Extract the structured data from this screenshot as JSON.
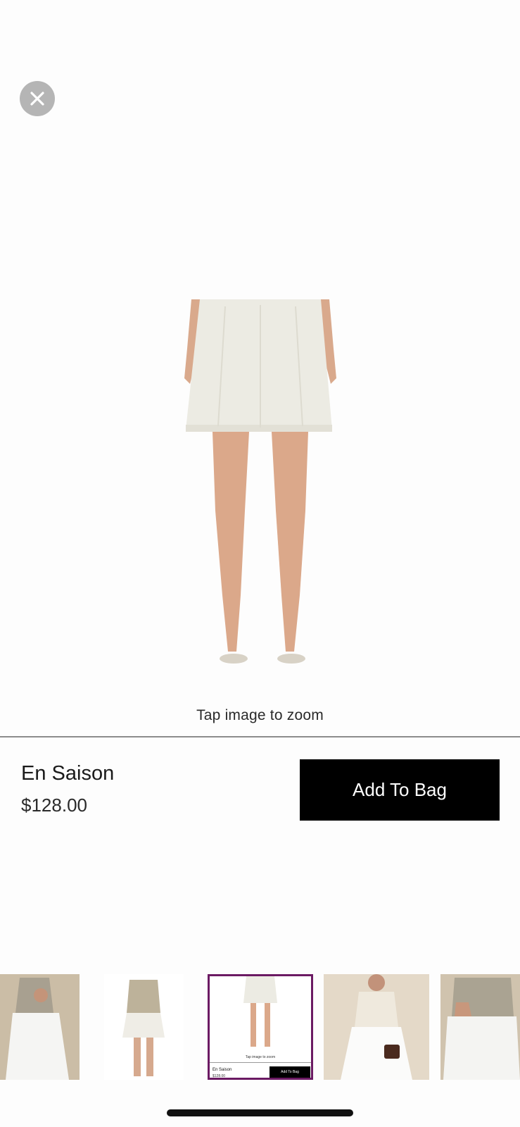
{
  "main": {
    "zoom_hint": "Tap image to zoom"
  },
  "product": {
    "name": "En Saison",
    "price": "$128.00",
    "add_to_bag_label": "Add To Bag"
  },
  "thumbnails": {
    "selected_index": 2,
    "selected_preview": {
      "zoom_hint": "Tap image to zoom",
      "name": "En Saison",
      "price": "$128.00",
      "button": "Add To Bag"
    }
  },
  "icons": {
    "close": "close-icon"
  },
  "colors": {
    "accent_selected": "#6b1a63",
    "button_bg": "#000000",
    "close_bg": "#b5b5b5"
  }
}
